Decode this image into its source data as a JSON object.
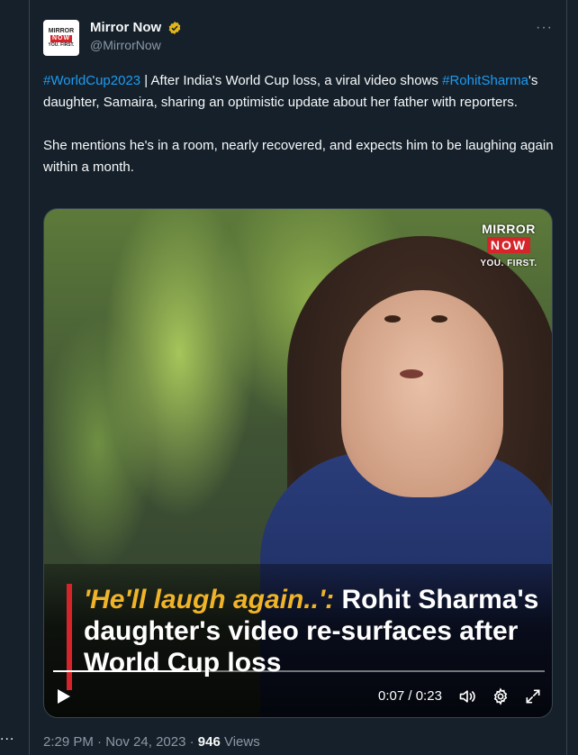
{
  "side": {
    "more_label": "..."
  },
  "author": {
    "name": "Mirror Now",
    "handle": "@MirrorNow",
    "avatar": {
      "line1": "MIRROR",
      "line2": "NOW",
      "line3": "YOU. FIRST."
    }
  },
  "tweet": {
    "hashtag1": "#WorldCup2023",
    "text1": " | After India's World Cup loss, a viral video shows ",
    "hashtag2": "#RohitSharma",
    "text2": "'s daughter, Samaira, sharing an optimistic update about her father with reporters.",
    "paragraph2": "She mentions he's in a room, nearly recovered, and expects him to be laughing again within a month."
  },
  "video": {
    "logo": {
      "line1": "MIRROR",
      "line2": "NOW",
      "line3": "YOU. FIRST."
    },
    "caption_quote": "'He'll laugh again..':",
    "caption_rest": " Rohit Sharma's daughter's video re-surfaces after World Cup loss",
    "current_time": "0:07",
    "total_time": "0:23",
    "time_separator": " / ",
    "progress": 0.3
  },
  "meta": {
    "time": "2:29 PM",
    "sep1": " · ",
    "date": "Nov 24, 2023",
    "sep2": " · ",
    "views_count": "946",
    "views_label": " Views"
  },
  "icons": {
    "verified": "verified-badge-icon",
    "more": "more-horizontal-icon",
    "play": "play-icon",
    "volume": "volume-icon",
    "settings": "settings-gear-icon",
    "fullscreen": "fullscreen-icon"
  },
  "colors": {
    "background": "#15202b",
    "link": "#1d9bf0",
    "secondary_text": "#8b98a5",
    "verified": "#e2b719",
    "brand_red": "#d6242b",
    "caption_accent": "#f0b429"
  }
}
